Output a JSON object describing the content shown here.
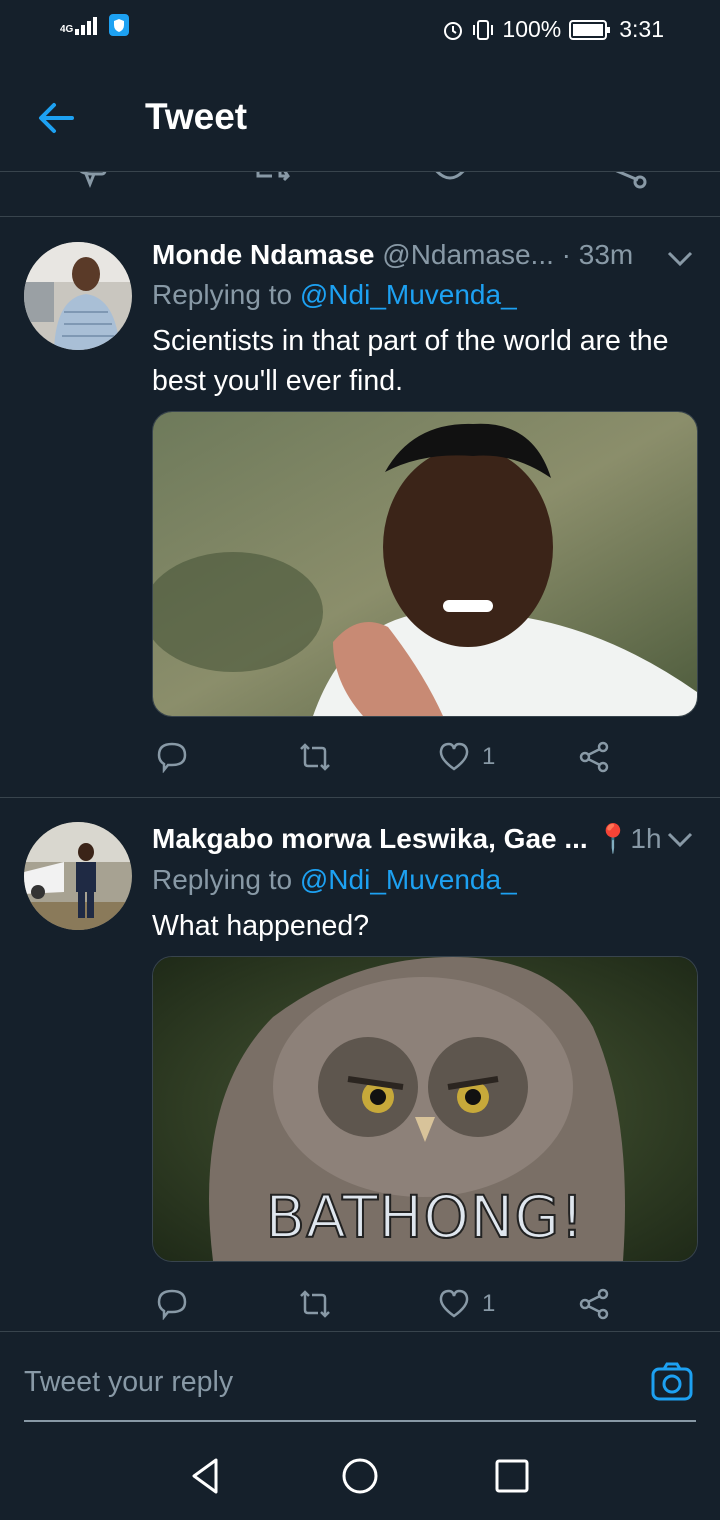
{
  "status_bar": {
    "network": "4G",
    "battery_pct": "100%",
    "time": "3:31"
  },
  "header": {
    "title": "Tweet",
    "back_icon": "arrow-left-icon"
  },
  "tweets": [
    {
      "display_name": "Monde Ndamase",
      "handle": "@Ndamase...",
      "time": "· 33m",
      "replying_to_prefix": "Replying to",
      "replying_to": "@Ndi_Muvenda_",
      "text": "Scientists in that part of the world are the best you'll ever find.",
      "media": "reaction-gif-man-shrugging",
      "likes": "1"
    },
    {
      "display_name": "Makgabo morwa Leswika, Gae ...",
      "handle": "",
      "location_emoji": "📍",
      "time": "1h",
      "replying_to_prefix": "Replying to",
      "replying_to": "@Ndi_Muvenda_",
      "text": "What happened?",
      "media_caption": "BATHONG!",
      "likes": "1"
    }
  ],
  "reply_bar": {
    "placeholder": "Tweet your reply"
  },
  "colors": {
    "background": "#15202b",
    "accent": "#1da1f2",
    "muted": "#8899a6",
    "divider": "#38444d"
  }
}
